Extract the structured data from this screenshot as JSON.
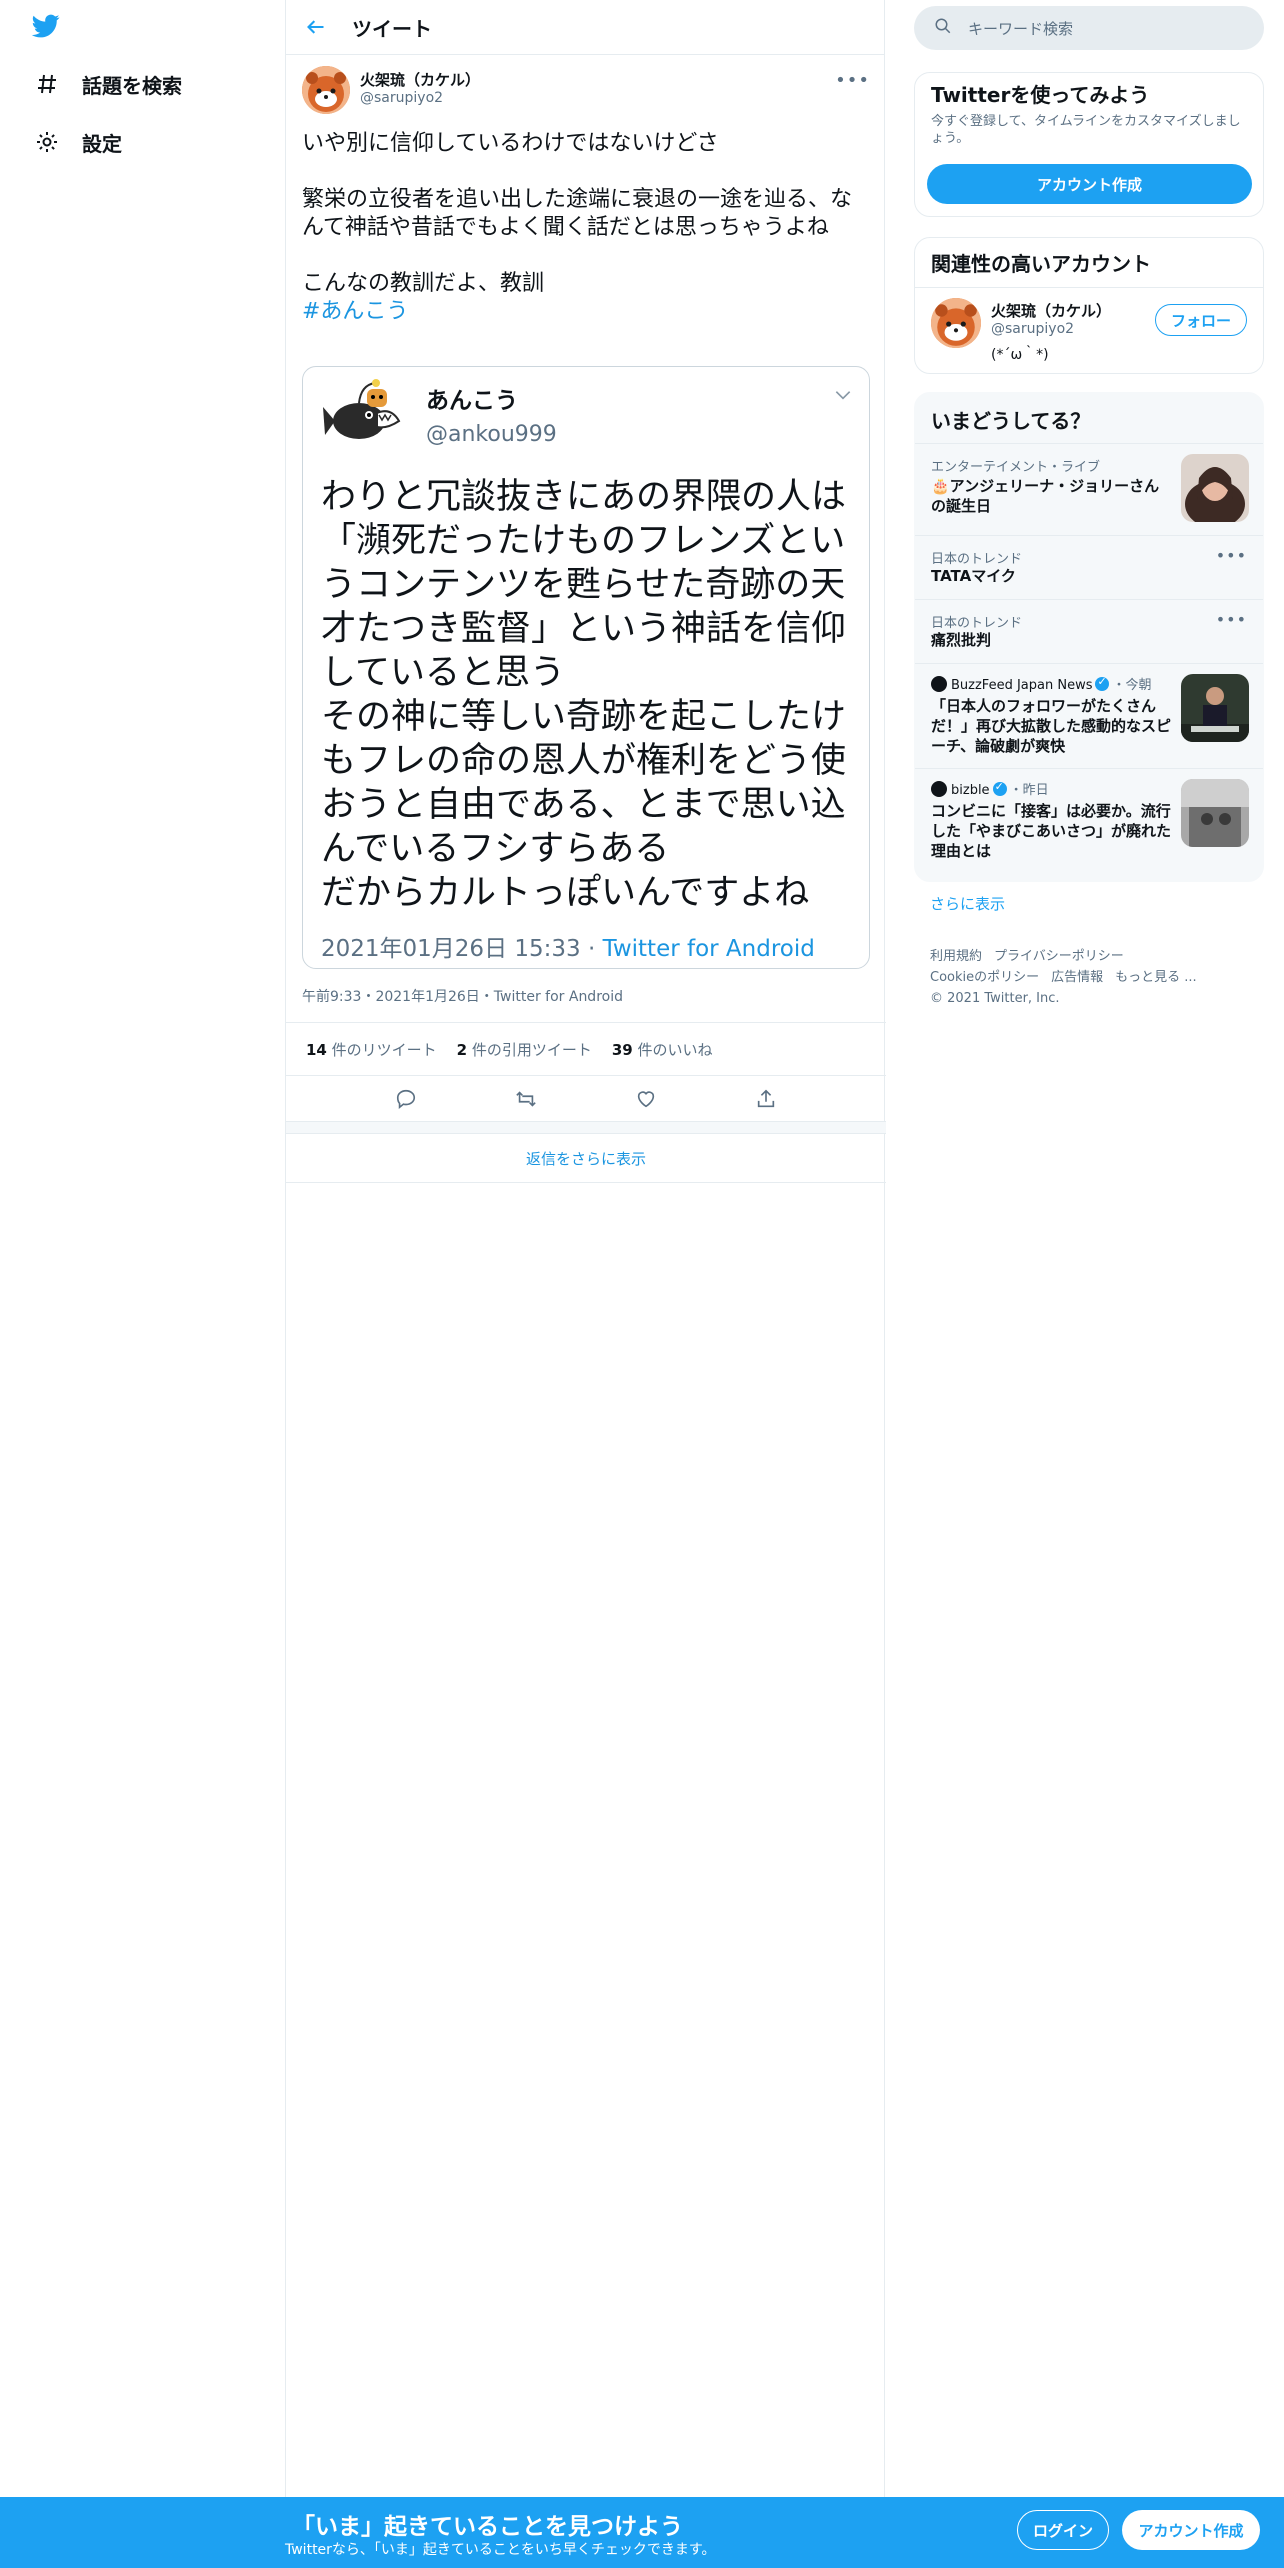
{
  "nav": {
    "logo": "twitter-bird-icon",
    "items": [
      {
        "label": "話題を検索",
        "icon": "hashtag-icon"
      },
      {
        "label": "設定",
        "icon": "gear-icon"
      }
    ]
  },
  "header": {
    "title": "ツイート"
  },
  "tweet": {
    "author_name": "火架琉（カケル）",
    "author_handle": "@sarupiyo2",
    "text": "いや別に信仰しているわけではないけどさ\n\n繁栄の立役者を追い出した途端に衰退の一途を辿る、なんて神話や昔話でもよく聞く話だとは思っちゃうよね\n\nこんなの教訓だよ、教訓",
    "hashtag": "#あんこう",
    "quote": {
      "name": "あんこう",
      "handle": "@ankou999",
      "text": "わりと冗談抜きにあの界隈の人は「瀕死だったけものフレンズというコンテンツを甦らせた奇跡の天才たつき監督」という神話を信仰していると思う\nその神に等しい奇跡を起こしたけもフレの命の恩人が権利をどう使おうと自由である、とまで思い込んでいるフシすらある\nだからカルトっぽいんですよね",
      "date": "2021年01月26日 15:33 · ",
      "source": "Twitter for Android"
    },
    "meta": "午前9:33・2021年1月26日・Twitter for Android",
    "stats": {
      "retweets_count": "14",
      "retweets_label": " 件のリツイート",
      "quotes_count": "2",
      "quotes_label": " 件の引用ツイート",
      "likes_count": "39",
      "likes_label": " 件のいいね"
    },
    "show_more_replies": "返信をさらに表示"
  },
  "search": {
    "placeholder": "キーワード検索"
  },
  "signup": {
    "title": "Twitterを使ってみよう",
    "subtitle": "今すぐ登録して、タイムラインをカスタマイズしましょう。",
    "button": "アカウント作成"
  },
  "related": {
    "title": "関連性の高いアカウント",
    "name": "火架琉（カケル）",
    "handle": "@sarupiyo2",
    "bio": "(*´ω｀*)",
    "follow": "フォロー"
  },
  "trends": {
    "title": "いまどうしてる？",
    "items": [
      {
        "category": "エンターテイメント・ライブ",
        "title": "🎂アンジェリーナ・ジョリーさんの誕生日"
      },
      {
        "category": "日本のトレンド",
        "title": "TATAマイク"
      },
      {
        "category": "日本のトレンド",
        "title": "痛烈批判"
      },
      {
        "source": "BuzzFeed Japan News",
        "time": "・今朝",
        "title": "「日本人のフォロワーがたくさんだ！」再び大拡散した感動的なスピーチ、論破劇が爽快"
      },
      {
        "source": "bizble",
        "time": "・昨日",
        "title": "コンビニに「接客」は必要か。流行した「やまびこあいさつ」が廃れた理由とは"
      }
    ],
    "show_more": "さらに表示"
  },
  "footer": {
    "links": [
      "利用規約",
      "プライバシーポリシー",
      "Cookieのポリシー",
      "広告情報",
      "もっと見る ..."
    ],
    "copyright": "© 2021 Twitter, Inc."
  },
  "bottombar": {
    "title": "「いま」起きていることを見つけよう",
    "subtitle": "Twitterなら、「いま」起きていることをいち早くチェックできます。",
    "login": "ログイン",
    "signup": "アカウント作成"
  },
  "colors": {
    "accent": "#1da1f2",
    "link": "#1b95e0",
    "muted": "#5b7083",
    "border": "#e6ecf0"
  }
}
